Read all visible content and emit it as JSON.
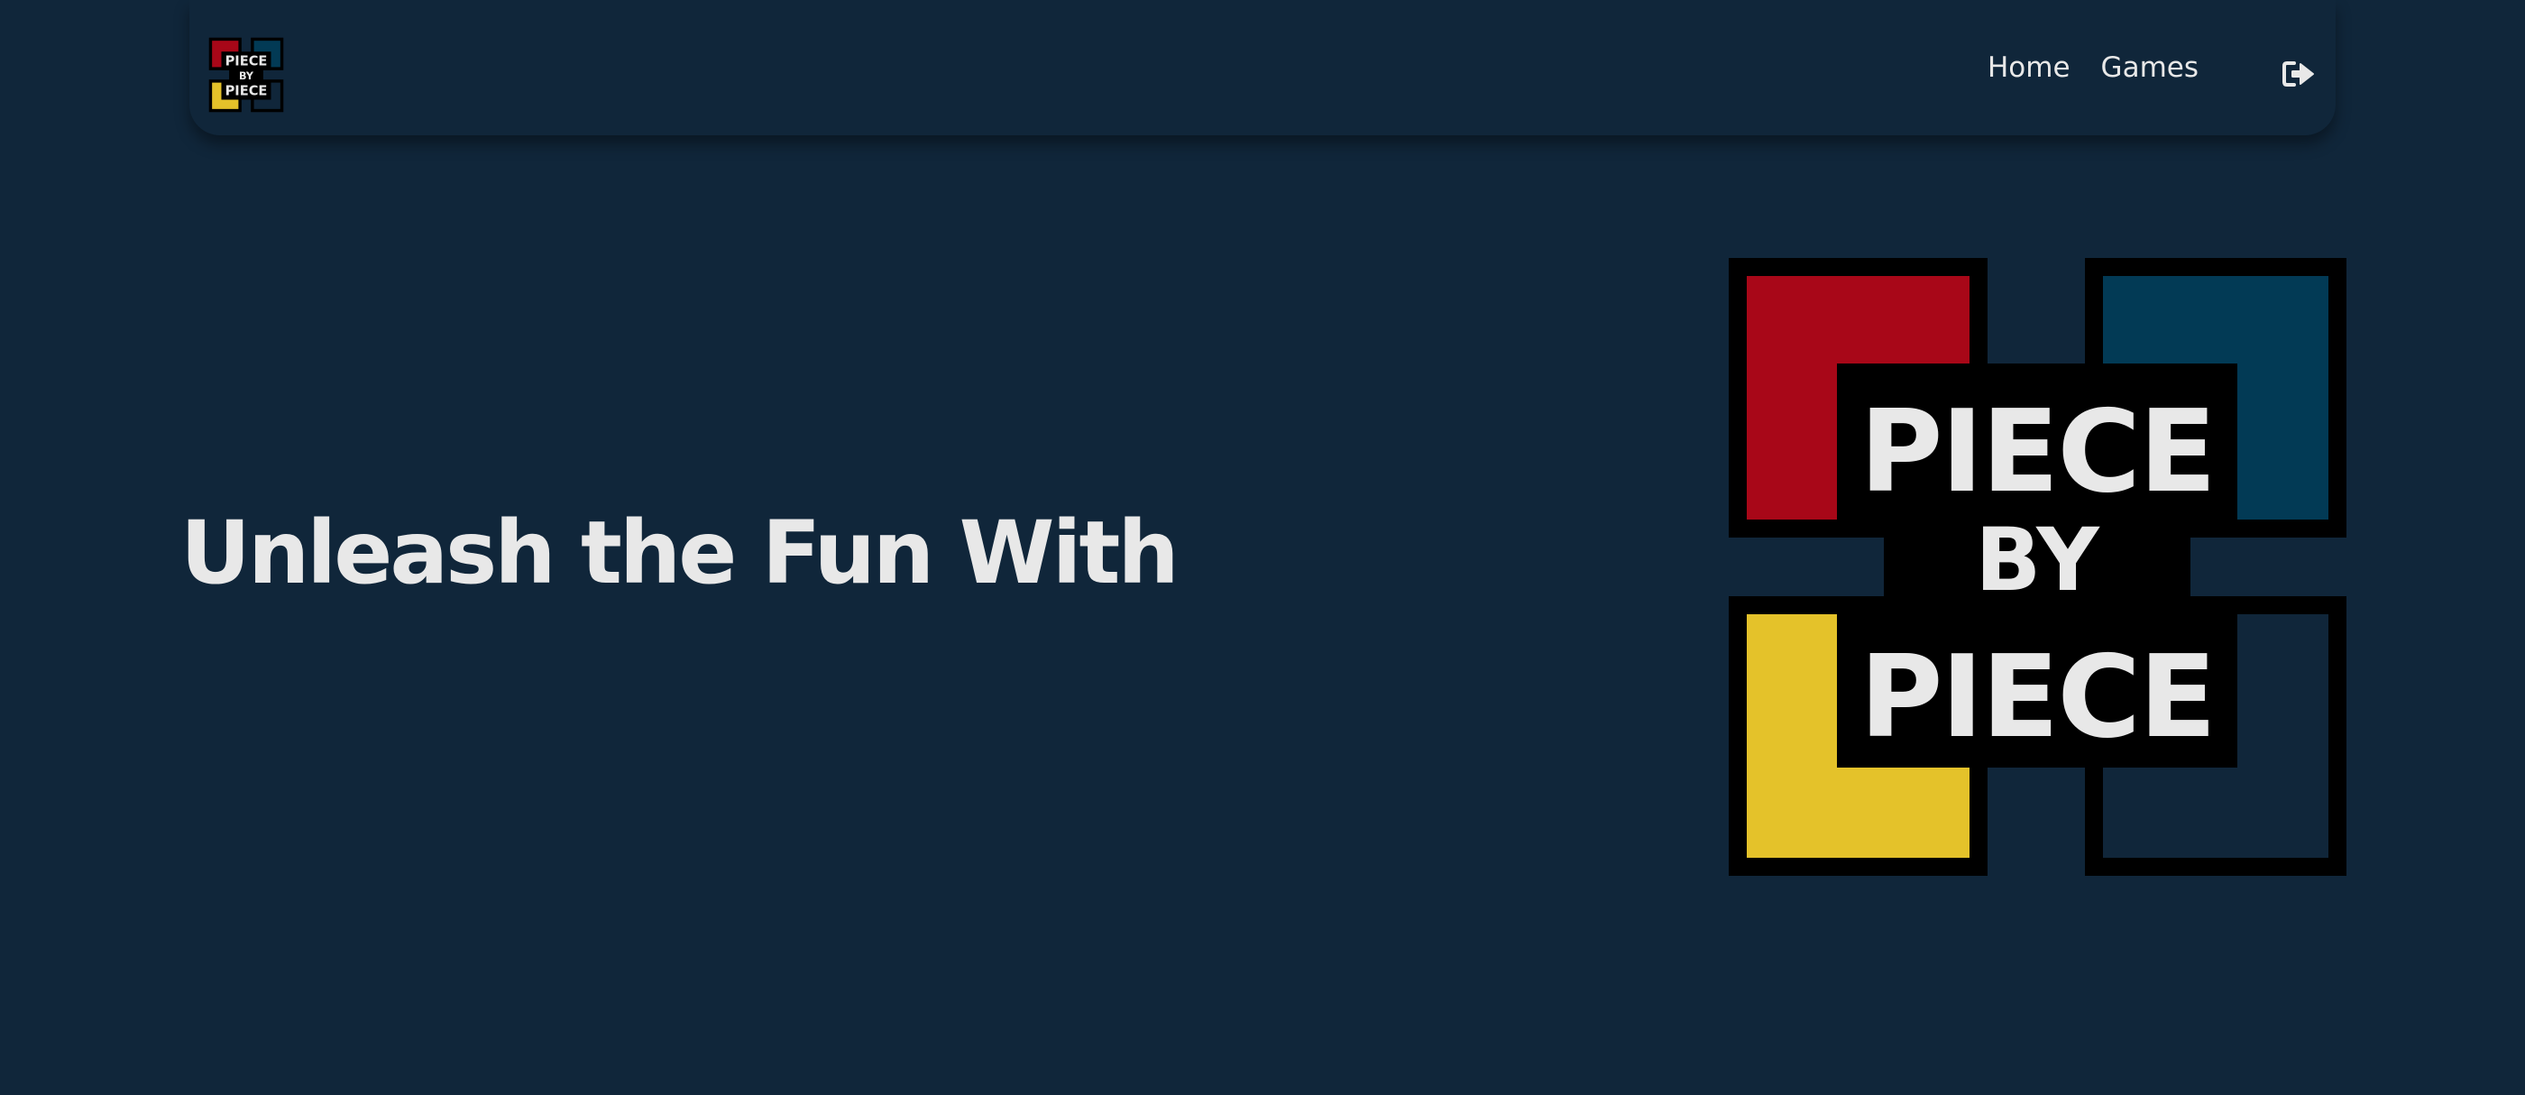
{
  "brand": {
    "logo_line1": "PIECE",
    "logo_line2": "BY",
    "logo_line3": "PIECE",
    "colors": {
      "red": "#a80718",
      "teal": "#023a55",
      "yellow": "#e4c22a",
      "navy": "#10263a",
      "black": "#000000",
      "text": "#e8e8e8"
    }
  },
  "nav": {
    "links": [
      {
        "label": "Home"
      },
      {
        "label": "Games"
      }
    ],
    "logout_icon": "sign-out-icon"
  },
  "hero": {
    "title": "Unleash the Fun With"
  }
}
